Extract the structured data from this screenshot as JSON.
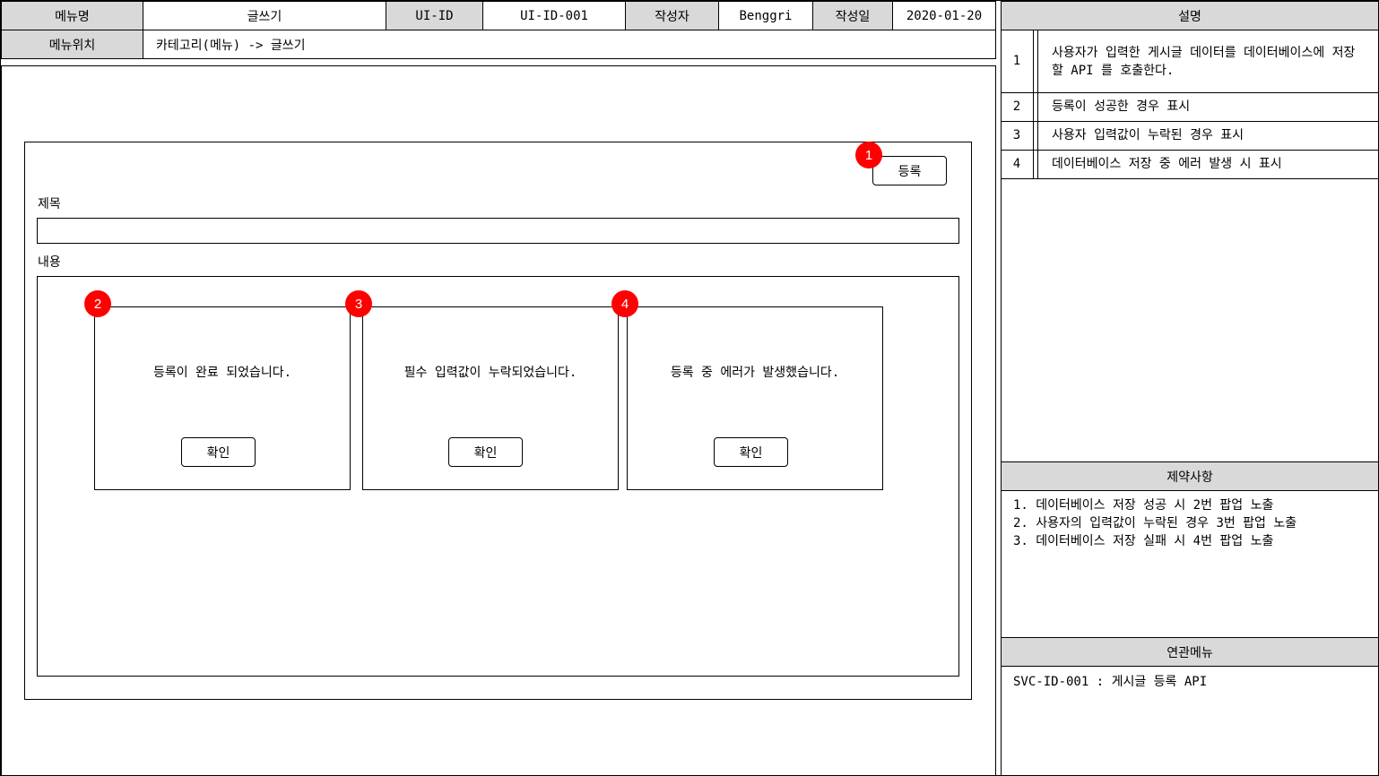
{
  "header": {
    "menu_name_label": "메뉴명",
    "menu_name_value": "글쓰기",
    "ui_id_label": "UI-ID",
    "ui_id_value": "UI-ID-001",
    "author_label": "작성자",
    "author_value": "Benggri",
    "date_label": "작성일",
    "date_value": "2020-01-20",
    "menu_location_label": "메뉴위치",
    "menu_location_value": "카테고리(메뉴) -> 글쓰기"
  },
  "form": {
    "register_button": "등록",
    "title_label": "제목",
    "title_value": "",
    "content_label": "내용"
  },
  "badges": [
    "1",
    "2",
    "3",
    "4"
  ],
  "badge_color": "#ff0000",
  "popups": [
    {
      "message": "등록이 완료 되었습니다.",
      "confirm": "확인"
    },
    {
      "message": "필수 입력값이 누락되었습니다.",
      "confirm": "확인"
    },
    {
      "message": "등록 중 에러가 발생했습니다.",
      "confirm": "확인"
    }
  ],
  "description": {
    "header": "설명",
    "items": [
      {
        "num": "1",
        "text": "사용자가 입력한 게시글 데이터를 데이터베이스에 저장할 API 를 호출한다."
      },
      {
        "num": "2",
        "text": "등록이 성공한 경우 표시"
      },
      {
        "num": "3",
        "text": "사용자 입력값이 누락된 경우 표시"
      },
      {
        "num": "4",
        "text": "데이터베이스 저장 중 에러 발생 시 표시"
      }
    ]
  },
  "constraints": {
    "header": "제약사항",
    "items": [
      "1. 데이터베이스 저장 성공 시 2번 팝업 노출",
      "2. 사용자의 입력값이 누락된 경우 3번 팝업 노출",
      "3. 데이터베이스 저장 실패 시 4번 팝업 노출"
    ]
  },
  "related_menu": {
    "header": "연관메뉴",
    "text": "SVC-ID-001 : 게시글 등록 API"
  }
}
